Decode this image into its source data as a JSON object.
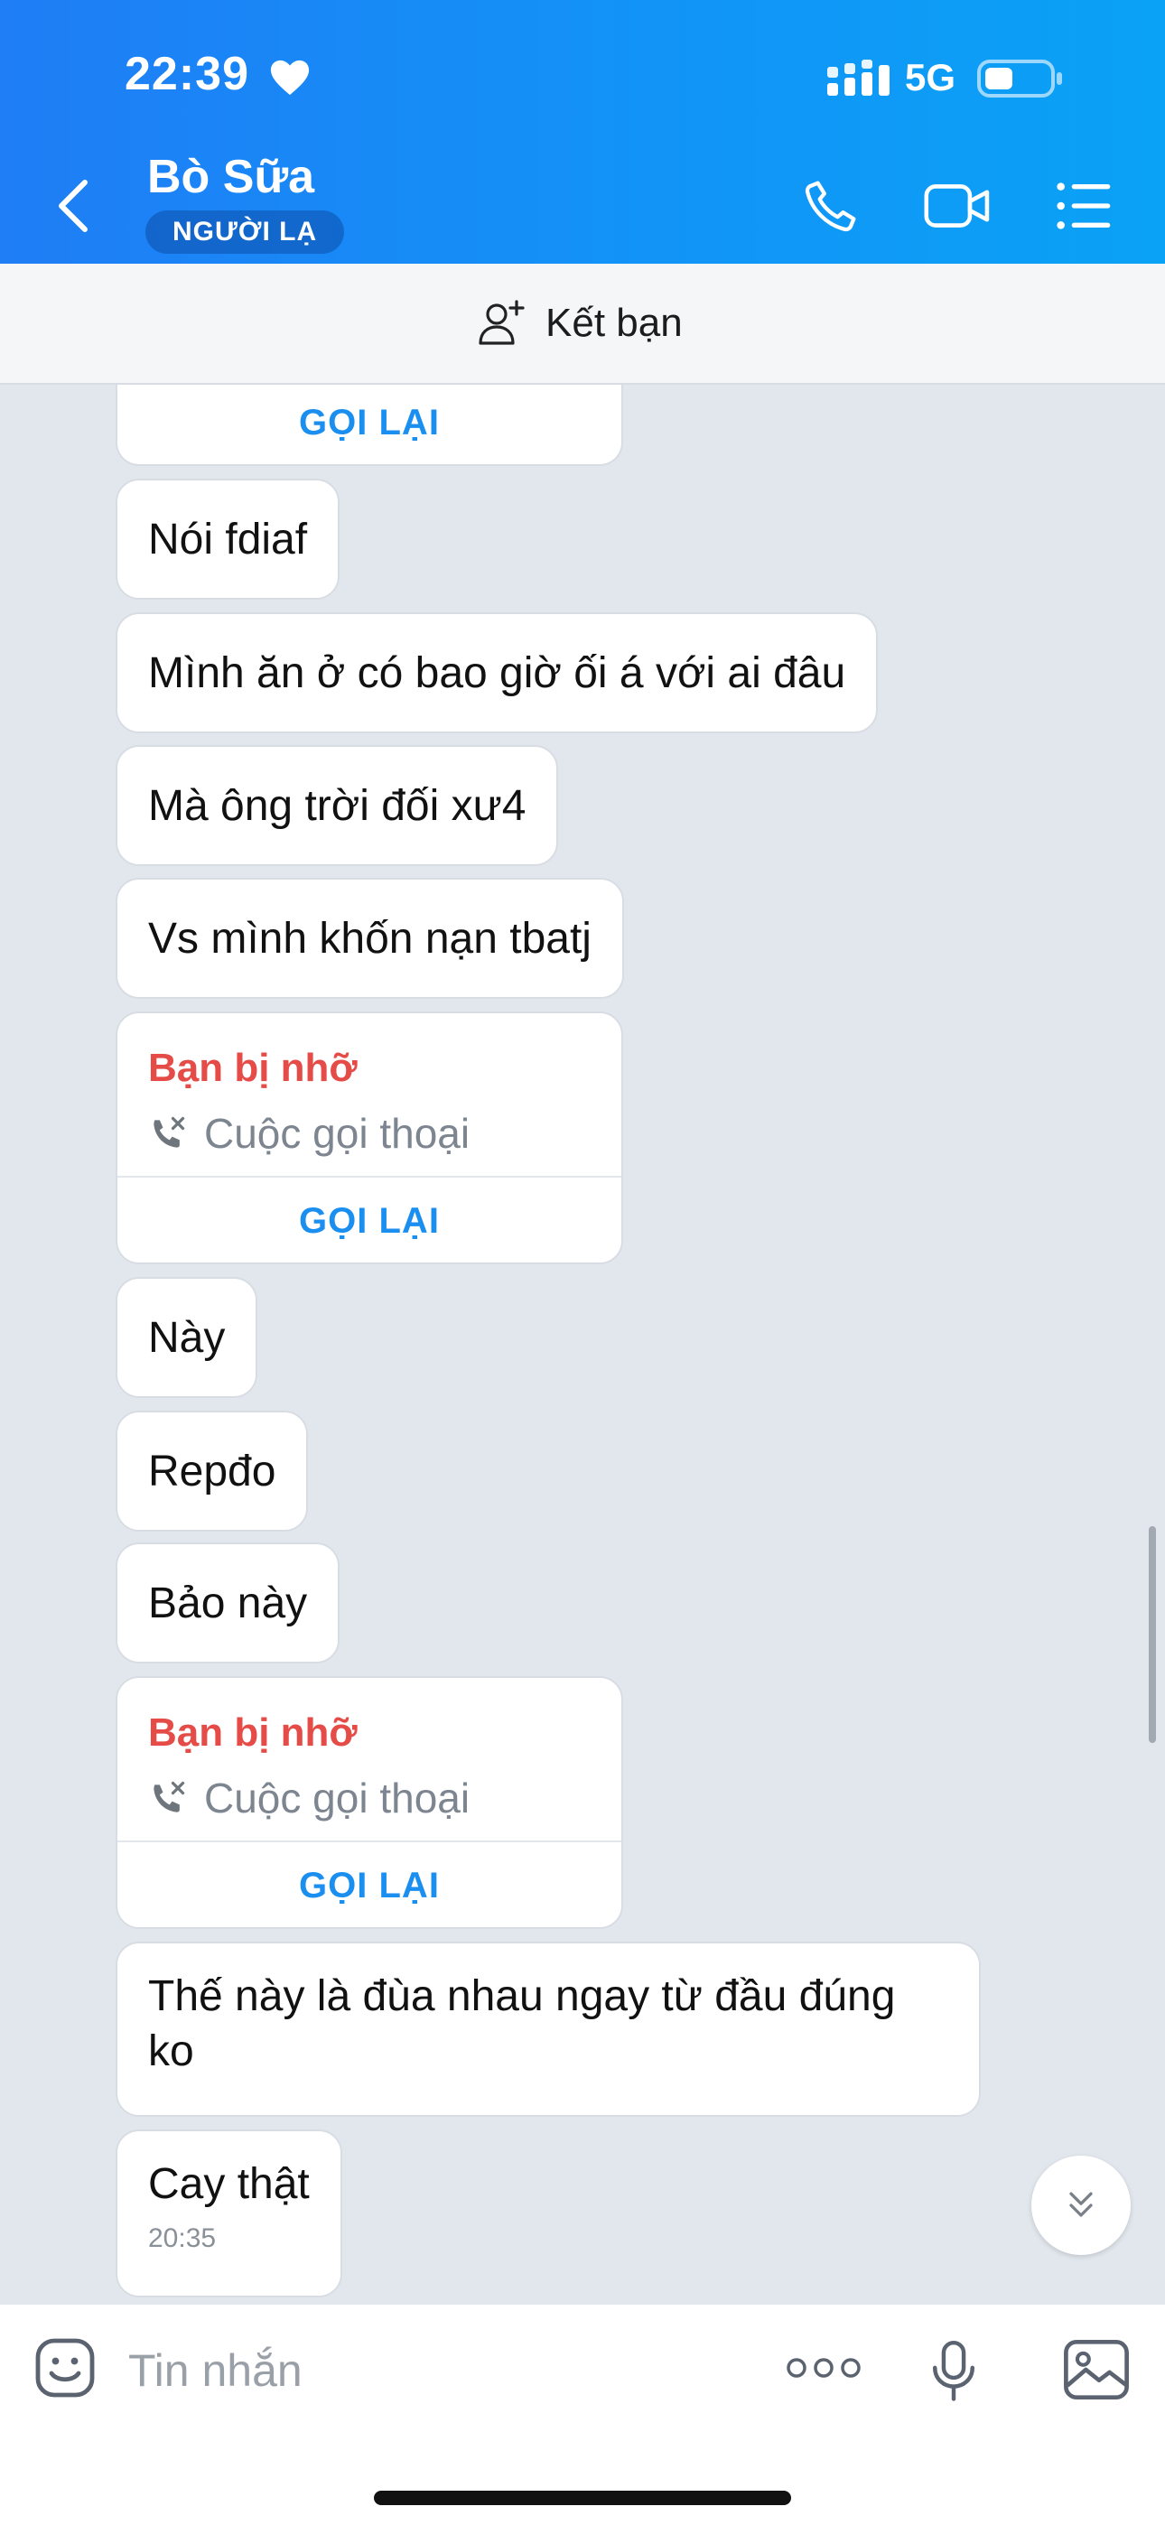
{
  "status_bar": {
    "time": "22:39",
    "network": "5G"
  },
  "header": {
    "contact_name": "Bò Sữa",
    "badge": "NGƯỜI LẠ"
  },
  "friend_bar": {
    "label": "Kết bạn"
  },
  "messages": {
    "m0": {
      "callback": "GỌI LẠI"
    },
    "m1": {
      "text": "Nói fdiaf"
    },
    "m2": {
      "text": "Mình ăn ở có bao giờ ối á với ai đâu"
    },
    "m3": {
      "text": "Mà ông trời đối xư4"
    },
    "m4": {
      "text": "Vs mình khốn nạn tbatj"
    },
    "m5": {
      "title": "Bạn bị nhỡ",
      "subtitle": "Cuộc gọi thoại",
      "callback": "GỌI LẠI"
    },
    "m6": {
      "text": "Này"
    },
    "m7": {
      "text": "Repđo"
    },
    "m8": {
      "text": "Bảo này"
    },
    "m9": {
      "title": "Bạn bị nhỡ",
      "subtitle": "Cuộc gọi thoại",
      "callback": "GỌI LẠI"
    },
    "m10": {
      "text": "Thế này là đùa nhau ngay từ đầu đúng ko"
    },
    "m11": {
      "text": "Cay thật",
      "time": "20:35"
    }
  },
  "composer": {
    "placeholder": "Tin nhắn"
  },
  "colors": {
    "header_start": "#1f7df5",
    "header_end": "#0aa2f6",
    "missed_call": "#e54b47",
    "callback": "#1b8ff0",
    "chat_bg": "#e2e7ee"
  },
  "icons": [
    "heart-icon",
    "signal-icon",
    "battery-icon",
    "back-icon",
    "phone-icon",
    "video-icon",
    "list-icon",
    "add-friend-icon",
    "missed-call-icon",
    "chevron-double-down-icon",
    "sticker-icon",
    "more-icon",
    "mic-icon",
    "image-icon"
  ]
}
